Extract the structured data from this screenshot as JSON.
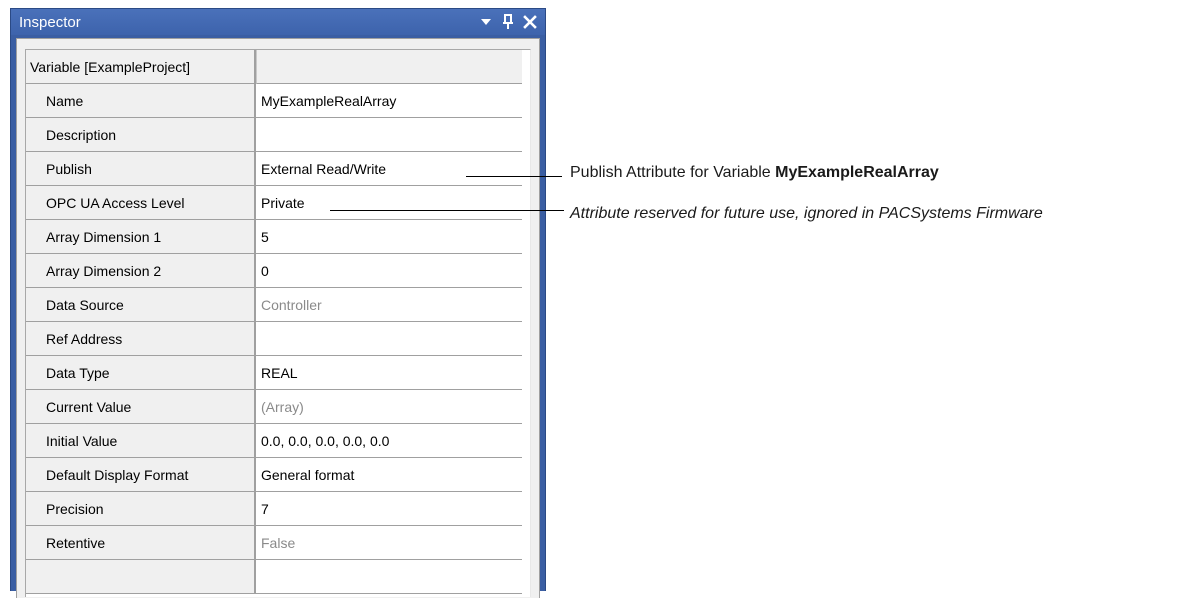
{
  "window": {
    "title": "Inspector",
    "buttons": [
      "dropdown-icon",
      "pin-icon",
      "close-icon"
    ]
  },
  "grid": {
    "header": {
      "name": "Variable [ExampleProject]",
      "value": ""
    },
    "rows": [
      {
        "name": "Name",
        "value": "MyExampleRealArray",
        "grey": false
      },
      {
        "name": "Description",
        "value": "",
        "grey": false
      },
      {
        "name": "Publish",
        "value": "External Read/Write",
        "grey": false
      },
      {
        "name": "OPC UA Access Level",
        "value": "Private",
        "grey": false
      },
      {
        "name": "Array Dimension 1",
        "value": "5",
        "grey": false
      },
      {
        "name": "Array Dimension 2",
        "value": "0",
        "grey": false
      },
      {
        "name": "Data Source",
        "value": "Controller",
        "grey": true
      },
      {
        "name": "Ref Address",
        "value": "",
        "grey": false
      },
      {
        "name": "Data Type",
        "value": "REAL",
        "grey": false
      },
      {
        "name": "Current Value",
        "value": "(Array)",
        "grey": true
      },
      {
        "name": "Initial Value",
        "value": "0.0, 0.0, 0.0, 0.0, 0.0",
        "grey": false
      },
      {
        "name": "Default Display Format",
        "value": "General format",
        "grey": false
      },
      {
        "name": "Precision",
        "value": "7",
        "grey": false
      },
      {
        "name": "Retentive",
        "value": "False",
        "grey": true
      },
      {
        "name": "",
        "value": "",
        "grey": false
      }
    ]
  },
  "annotations": {
    "publish": {
      "prefix": "Publish Attribute for Variable ",
      "bold": "MyExampleRealArray"
    },
    "opcua": {
      "text": "Attribute reserved for future use, ignored in PACSystems Firmware"
    }
  },
  "colors": {
    "titlebar": "#3d63ac",
    "grid_background": "#f0f0f0",
    "grid_line": "#a0a0a0",
    "disabled_text": "#8a8a8a"
  }
}
